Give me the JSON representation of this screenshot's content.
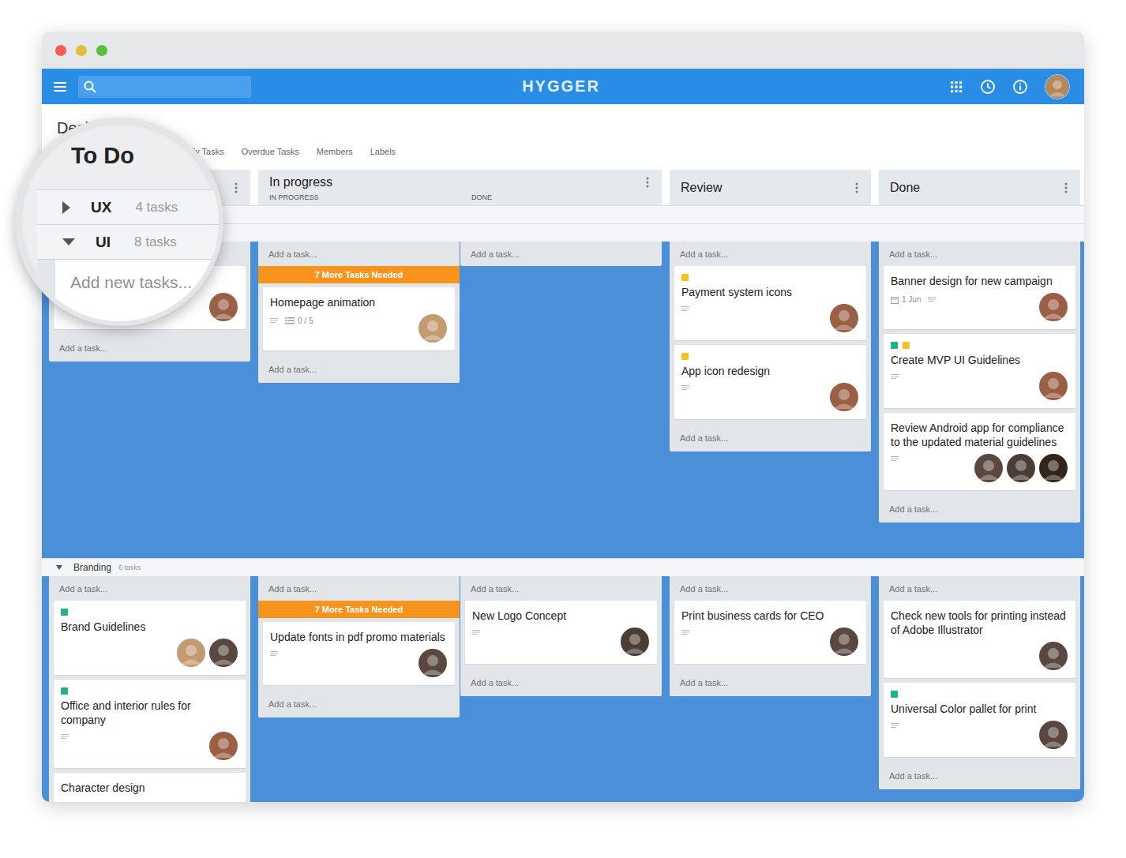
{
  "app": {
    "logo": "HYGGER",
    "user": {
      "color": "#b5875d"
    }
  },
  "board": {
    "title": "Design",
    "star": "☆"
  },
  "tabs": [
    {
      "label": "My Tasks",
      "selected": false
    },
    {
      "label": "Overdue Tasks",
      "selected": false
    },
    {
      "label": "Members",
      "selected": false
    },
    {
      "label": "Labels",
      "selected": false
    }
  ],
  "columns": [
    {
      "title": "To Do",
      "subcolumns": []
    },
    {
      "title": "In progress",
      "subcolumns": [
        {
          "label": "IN PROGRESS",
          "selected": true
        },
        {
          "label": "DONE",
          "selected": false
        }
      ]
    },
    {
      "title": "Review",
      "subcolumns": []
    },
    {
      "title": "Done",
      "subcolumns": []
    }
  ],
  "lanes": [
    {
      "name": "UX",
      "count": "4 tasks",
      "expanded": false,
      "cells": []
    },
    {
      "name": "UI",
      "count": "8 tasks",
      "expanded": true,
      "cells": [
        {
          "add_top": "Add a task...",
          "cards": [
            {
              "labels": [],
              "description": false,
              "assignees": [
                {
                  "color": "#9b5f45"
                }
              ]
            }
          ],
          "add_bottom": "Add a task..."
        },
        {
          "add_top": "Add a task...",
          "notice": "7 More Tasks Needed",
          "cards": [
            {
              "title": "Homepage animation",
              "labels": [],
              "description": true,
              "checklist": "0 / 5",
              "assignees": [
                {
                  "color": "#c49a70"
                }
              ]
            }
          ],
          "add_bottom": "Add a task..."
        },
        {
          "add_top": "Add a task...",
          "cards": []
        },
        {
          "add_top": "Add a task...",
          "cards": [
            {
              "title": "Payment system icons",
              "labels": [
                {
                  "color": "#f7c21c"
                }
              ],
              "description": true,
              "assignees": [
                {
                  "color": "#9b5f45"
                }
              ]
            },
            {
              "title": "App icon redesign",
              "labels": [
                {
                  "color": "#f7c21c"
                }
              ],
              "description": true,
              "assignees": [
                {
                  "color": "#9b5f45"
                }
              ]
            }
          ],
          "add_bottom": "Add a task..."
        },
        {
          "add_top": "Add a task...",
          "cards": [
            {
              "title": "Banner design for new campaign",
              "labels": [],
              "date": "1 Jun",
              "description": true,
              "assignees": [
                {
                  "color": "#9b5f45"
                }
              ]
            },
            {
              "title": "Create MVP UI Guidelines",
              "labels": [
                {
                  "color": "#1db48d"
                },
                {
                  "color": "#f7c21c"
                }
              ],
              "description": true,
              "assignees": [
                {
                  "color": "#9b5f45"
                }
              ]
            },
            {
              "title": "Review Android app for compliance to the updated material guidelines",
              "labels": [],
              "description": true,
              "assignees": [
                {
                  "color": "#5a4840"
                },
                {
                  "color": "#4a3d36"
                },
                {
                  "color": "#35241c"
                }
              ]
            }
          ],
          "add_bottom": "Add a task..."
        }
      ]
    },
    {
      "name": "Branding",
      "count": "6 tasks",
      "expanded": true,
      "cells": [
        {
          "add_top": "Add a task...",
          "cards": [
            {
              "title": "Brand Guidelines",
              "labels": [
                {
                  "color": "#1db48d"
                }
              ],
              "description": false,
              "assignees": [
                {
                  "color": "#c49a70"
                },
                {
                  "color": "#5a4840"
                }
              ]
            },
            {
              "title": "Office and interior rules for company",
              "labels": [
                {
                  "color": "#1db48d"
                }
              ],
              "description": true,
              "assignees": [
                {
                  "color": "#9b5f45"
                }
              ]
            },
            {
              "title": "Character design",
              "labels": [],
              "description": false,
              "assignees": []
            }
          ]
        },
        {
          "add_top": "Add a task...",
          "notice": "7 More Tasks Needed",
          "cards": [
            {
              "title": "Update fonts in pdf promo materials",
              "labels": [],
              "description": true,
              "assignees": [
                {
                  "color": "#5a4840"
                }
              ]
            }
          ],
          "add_bottom": "Add a task..."
        },
        {
          "add_top": "Add a task...",
          "cards": [
            {
              "title": "New Logo Concept",
              "labels": [],
              "description": true,
              "assignees": [
                {
                  "color": "#4a3d36"
                }
              ]
            }
          ],
          "add_bottom": "Add a task..."
        },
        {
          "add_top": "Add a task...",
          "cards": [
            {
              "title": "Print business cards for CEO",
              "labels": [],
              "description": true,
              "assignees": [
                {
                  "color": "#5a4840"
                }
              ]
            }
          ],
          "add_bottom": "Add a task..."
        },
        {
          "add_top": "Add a task...",
          "cards": [
            {
              "title": "Check new tools for printing instead of Adobe Illustrator",
              "labels": [],
              "description": false,
              "assignees": [
                {
                  "color": "#5a4840"
                }
              ]
            },
            {
              "title": "Universal Color pallet for print",
              "labels": [
                {
                  "color": "#1db48d"
                }
              ],
              "description": true,
              "assignees": [
                {
                  "color": "#5a4840"
                }
              ]
            }
          ],
          "add_bottom": "Add a task..."
        }
      ]
    }
  ],
  "magnifier": {
    "add_label": "Add new tasks..."
  }
}
